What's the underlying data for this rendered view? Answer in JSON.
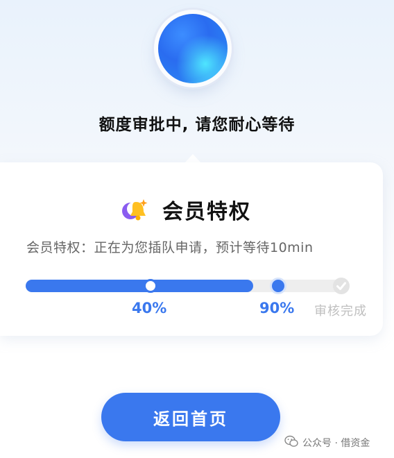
{
  "status": {
    "headline": "额度审批中, 请您耐心等待"
  },
  "membership": {
    "title": "会员特权",
    "subtitle": "会员特权：正在为您插队申请，预计等待10min",
    "progress": {
      "value_percent": 90,
      "milestones": [
        {
          "label": "40%",
          "value_percent": 40,
          "state": "passed"
        },
        {
          "label": "90%",
          "value_percent": 90,
          "state": "current"
        },
        {
          "label": "审核完成",
          "value_percent": 100,
          "state": "pending"
        }
      ]
    }
  },
  "actions": {
    "home_label": "返回首页"
  },
  "watermark": {
    "text": "公众号 · 借资金"
  },
  "colors": {
    "accent": "#3a78ee",
    "track": "#eeeeee",
    "pending": "#bfbfbf"
  }
}
